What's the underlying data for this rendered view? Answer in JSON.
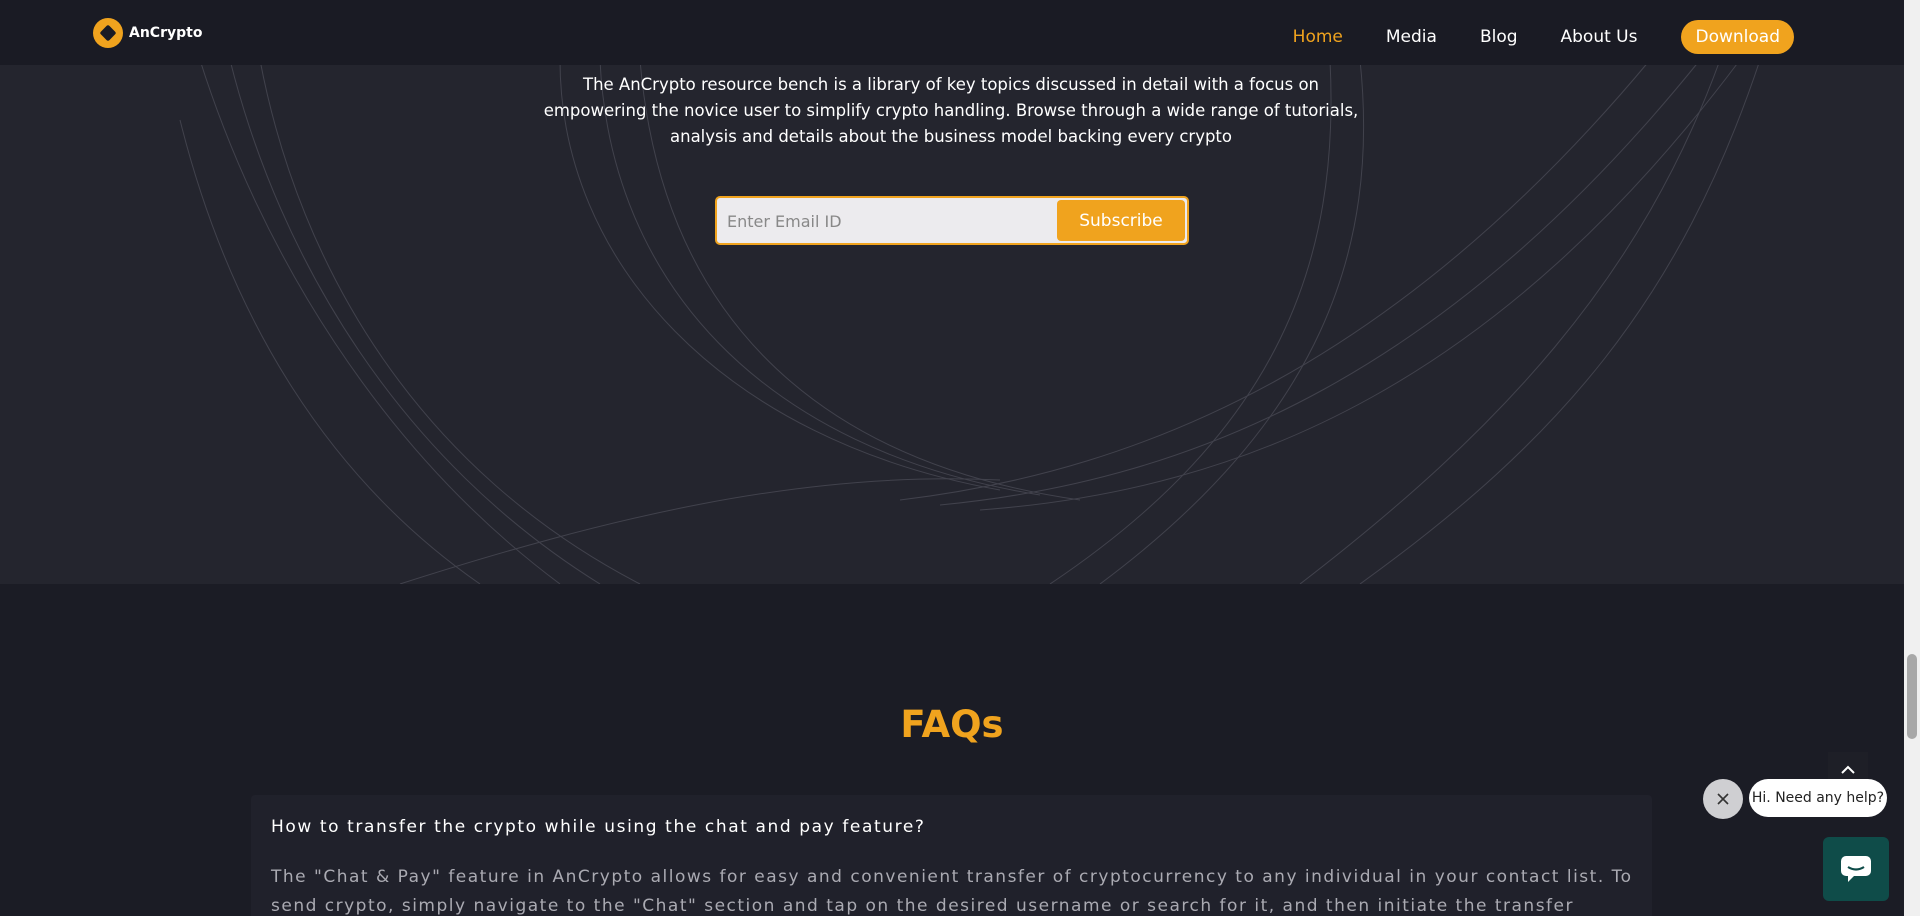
{
  "brand": {
    "name": "AnCrypto"
  },
  "nav": {
    "items": [
      {
        "label": "Home",
        "active": true
      },
      {
        "label": "Media",
        "active": false
      },
      {
        "label": "Blog",
        "active": false
      },
      {
        "label": "About Us",
        "active": false
      }
    ],
    "download_label": "Download"
  },
  "hero": {
    "description": "The AnCrypto resource bench is a library of key topics discussed in detail with a focus on empowering the novice user to simplify crypto handling. Browse through a wide range of tutorials, analysis and details about the business model backing every crypto",
    "email_placeholder": "Enter Email ID",
    "subscribe_label": "Subscribe"
  },
  "faq": {
    "title": "FAQs",
    "items": [
      {
        "question": "How to transfer the crypto while using the chat and pay feature?",
        "answer": "The \"Chat & Pay\" feature in AnCrypto allows for easy and convenient transfer of cryptocurrency to any individual in your contact list. To send crypto, simply navigate to the \"Chat\" section and tap on the desired username or search for it, and then initiate the transfer"
      }
    ]
  },
  "chat_widget": {
    "greeting": "Hi. Need any help?"
  },
  "colors": {
    "accent": "#f0a31e",
    "background": "#1b1c25",
    "hero_background": "#24252e",
    "chat_button": "#0f4c49"
  },
  "icons": {
    "logo": "ancrypto-logo-icon",
    "close": "close-icon",
    "scroll_top": "chevron-up-icon",
    "chat": "chat-icon"
  }
}
